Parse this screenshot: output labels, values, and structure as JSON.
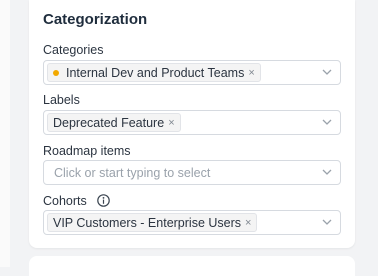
{
  "section": {
    "title": "Categorization"
  },
  "fields": {
    "categories": {
      "label": "Categories",
      "chips": [
        {
          "text": "Internal Dev and Product Teams",
          "dot_color": "#f2a900"
        }
      ]
    },
    "labels": {
      "label": "Labels",
      "chips": [
        {
          "text": "Deprecated Feature"
        }
      ]
    },
    "roadmap_items": {
      "label": "Roadmap items",
      "placeholder": "Click or start typing to select"
    },
    "cohorts": {
      "label": "Cohorts",
      "chips": [
        {
          "text": "VIP Customers - Enterprise Users"
        }
      ]
    }
  },
  "icons": {
    "remove": "×",
    "dropdown": "chevron-down-icon",
    "info": "info-icon"
  },
  "colors": {
    "category_dot": "#f2a900",
    "border": "#d6dae0"
  }
}
